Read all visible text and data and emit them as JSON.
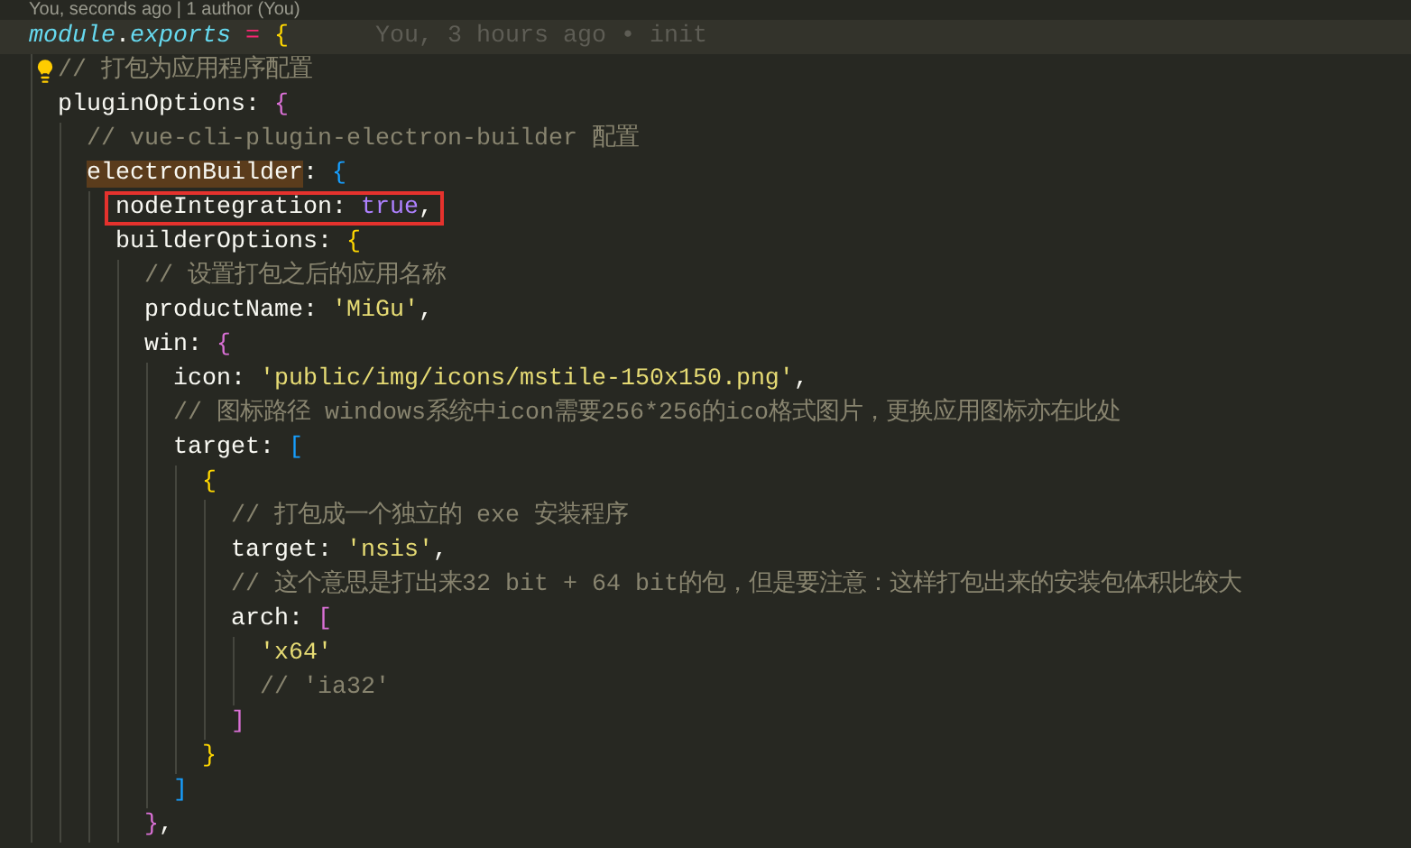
{
  "codelens": "You, seconds ago | 1 author (You)",
  "lines": [
    {
      "tokens": [
        {
          "kind": "var",
          "text": "module"
        },
        {
          "kind": "punct",
          "text": "."
        },
        {
          "kind": "var",
          "text": "exports"
        },
        {
          "kind": "op",
          "text": " = "
        },
        {
          "kind": "bracket",
          "text": "{",
          "color": "#ffd700"
        }
      ],
      "current": true,
      "blame": "You, 3 hours ago • init",
      "children": [
        {
          "tokens": [
            {
              "kind": "comment",
              "text": "// 打包为应用程序配置"
            }
          ],
          "lightbulb": true
        },
        {
          "tokens": [
            {
              "kind": "key",
              "text": "pluginOptions"
            },
            {
              "kind": "punct",
              "text": ": "
            },
            {
              "kind": "bracket",
              "text": "{",
              "color": "#da70d6"
            }
          ],
          "children": [
            {
              "tokens": [
                {
                  "kind": "comment",
                  "text": "// vue-cli-plugin-electron-builder 配置"
                }
              ]
            },
            {
              "tokens": [
                {
                  "kind": "key",
                  "text": "electronBuilder",
                  "highlighted": true
                },
                {
                  "kind": "punct",
                  "text": ": "
                },
                {
                  "kind": "bracket",
                  "text": "{",
                  "color": "#179fff"
                }
              ],
              "children": [
                {
                  "tokens": [
                    {
                      "kind": "key",
                      "text": "nodeIntegration"
                    },
                    {
                      "kind": "punct",
                      "text": ": "
                    },
                    {
                      "kind": "bool",
                      "text": "true"
                    },
                    {
                      "kind": "punct",
                      "text": ","
                    }
                  ],
                  "boxed": true
                },
                {
                  "tokens": [
                    {
                      "kind": "key",
                      "text": "builderOptions"
                    },
                    {
                      "kind": "punct",
                      "text": ": "
                    },
                    {
                      "kind": "bracket",
                      "text": "{",
                      "color": "#ffd700"
                    }
                  ],
                  "children": [
                    {
                      "tokens": [
                        {
                          "kind": "comment",
                          "text": "// 设置打包之后的应用名称"
                        }
                      ]
                    },
                    {
                      "tokens": [
                        {
                          "kind": "key",
                          "text": "productName"
                        },
                        {
                          "kind": "punct",
                          "text": ": "
                        },
                        {
                          "kind": "str",
                          "text": "'MiGu'"
                        },
                        {
                          "kind": "punct",
                          "text": ","
                        }
                      ]
                    },
                    {
                      "tokens": [
                        {
                          "kind": "key",
                          "text": "win"
                        },
                        {
                          "kind": "punct",
                          "text": ": "
                        },
                        {
                          "kind": "bracket",
                          "text": "{",
                          "color": "#da70d6"
                        }
                      ],
                      "children": [
                        {
                          "tokens": [
                            {
                              "kind": "key",
                              "text": "icon"
                            },
                            {
                              "kind": "punct",
                              "text": ": "
                            },
                            {
                              "kind": "str",
                              "text": "'public/img/icons/mstile-150x150.png'"
                            },
                            {
                              "kind": "punct",
                              "text": ","
                            }
                          ]
                        },
                        {
                          "tokens": [
                            {
                              "kind": "comment",
                              "text": "// 图标路径 windows系统中icon需要256*256的ico格式图片，更换应用图标亦在此处"
                            }
                          ]
                        },
                        {
                          "tokens": [
                            {
                              "kind": "key",
                              "text": "target"
                            },
                            {
                              "kind": "punct",
                              "text": ": "
                            },
                            {
                              "kind": "bracket",
                              "text": "[",
                              "color": "#179fff"
                            }
                          ],
                          "children": [
                            {
                              "tokens": [
                                {
                                  "kind": "bracket",
                                  "text": "{",
                                  "color": "#ffd700"
                                }
                              ],
                              "children": [
                                {
                                  "tokens": [
                                    {
                                      "kind": "comment",
                                      "text": "// 打包成一个独立的 exe 安装程序"
                                    }
                                  ]
                                },
                                {
                                  "tokens": [
                                    {
                                      "kind": "key",
                                      "text": "target"
                                    },
                                    {
                                      "kind": "punct",
                                      "text": ": "
                                    },
                                    {
                                      "kind": "str",
                                      "text": "'nsis'"
                                    },
                                    {
                                      "kind": "punct",
                                      "text": ","
                                    }
                                  ]
                                },
                                {
                                  "tokens": [
                                    {
                                      "kind": "comment",
                                      "text": "// 这个意思是打出来32 bit + 64 bit的包，但是要注意：这样打包出来的安装包体积比较大"
                                    }
                                  ]
                                },
                                {
                                  "tokens": [
                                    {
                                      "kind": "key",
                                      "text": "arch"
                                    },
                                    {
                                      "kind": "punct",
                                      "text": ": "
                                    },
                                    {
                                      "kind": "bracket",
                                      "text": "[",
                                      "color": "#da70d6"
                                    }
                                  ],
                                  "children": [
                                    {
                                      "tokens": [
                                        {
                                          "kind": "str",
                                          "text": "'x64'"
                                        }
                                      ]
                                    },
                                    {
                                      "tokens": [
                                        {
                                          "kind": "comment",
                                          "text": "// 'ia32'"
                                        }
                                      ]
                                    }
                                  ]
                                },
                                {
                                  "tokens": [
                                    {
                                      "kind": "bracket",
                                      "text": "]",
                                      "color": "#da70d6"
                                    }
                                  ]
                                }
                              ]
                            },
                            {
                              "tokens": [
                                {
                                  "kind": "bracket",
                                  "text": "}",
                                  "color": "#ffd700"
                                }
                              ]
                            }
                          ]
                        },
                        {
                          "tokens": [
                            {
                              "kind": "bracket",
                              "text": "]",
                              "color": "#179fff"
                            }
                          ]
                        }
                      ]
                    },
                    {
                      "tokens": [
                        {
                          "kind": "bracket",
                          "text": "}",
                          "color": "#da70d6"
                        },
                        {
                          "kind": "punct",
                          "text": ","
                        }
                      ]
                    }
                  ]
                }
              ]
            }
          ]
        }
      ]
    }
  ]
}
